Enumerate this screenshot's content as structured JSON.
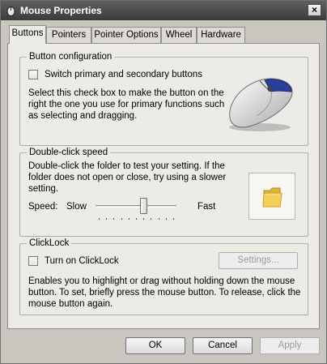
{
  "window": {
    "title": "Mouse Properties",
    "close_glyph": "×"
  },
  "tabs": [
    {
      "label": "Buttons",
      "active": true
    },
    {
      "label": "Pointers",
      "active": false
    },
    {
      "label": "Pointer Options",
      "active": false
    },
    {
      "label": "Wheel",
      "active": false
    },
    {
      "label": "Hardware",
      "active": false
    }
  ],
  "button_configuration": {
    "legend": "Button configuration",
    "checkbox_label": "Switch primary and secondary buttons",
    "checked": false,
    "description_lines": [
      "Select this check box to make the button on the",
      "right the one you use for primary functions such",
      "as selecting and dragging."
    ],
    "image_icon": "mouse-icon"
  },
  "double_click": {
    "legend": "Double-click speed",
    "description_lines": [
      "Double-click the folder to test your setting. If the",
      "folder does not open or close, try using a slower",
      "setting."
    ],
    "speed_label": "Speed:",
    "slow_label": "Slow",
    "fast_label": "Fast",
    "speed_fraction": 0.6,
    "test_icon": "folder-icon"
  },
  "clicklock": {
    "legend": "ClickLock",
    "checkbox_label": "Turn on ClickLock",
    "checked": false,
    "settings_label": "Settings...",
    "description_lines": [
      "Enables you to highlight or drag without holding down the mouse",
      "button. To set, briefly press the mouse button. To release, click the",
      "mouse button again."
    ]
  },
  "footer": {
    "ok_label": "OK",
    "cancel_label": "Cancel",
    "apply_label": "Apply"
  },
  "colors": {
    "accent_blue": "#2b3f9c",
    "folder_yellow": "#f3cf56"
  }
}
